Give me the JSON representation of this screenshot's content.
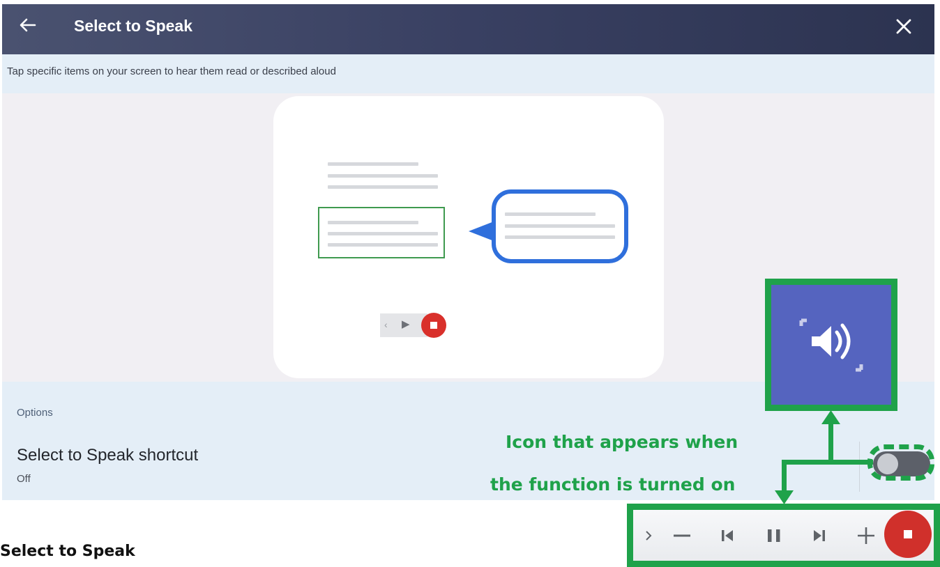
{
  "header": {
    "title": "Select to Speak",
    "back_icon": "arrow-left-icon",
    "close_icon": "close-icon"
  },
  "subtitle": "Tap specific items on your screen to hear them read or described aloud",
  "options": {
    "section_label": "Options",
    "shortcut_label": "Select to Speak shortcut",
    "shortcut_status": "Off",
    "toggle_state": "off"
  },
  "annotation": {
    "line1": "Icon that appears when",
    "line2": "the function is turned on"
  },
  "footer": {
    "caption": "Select to Speak"
  },
  "colors": {
    "header": "#394062",
    "highlight_green": "#1fa24a",
    "icon_panel": "#5564bf",
    "stop_red": "#d0302b",
    "bubble_blue": "#2f6fdc"
  }
}
